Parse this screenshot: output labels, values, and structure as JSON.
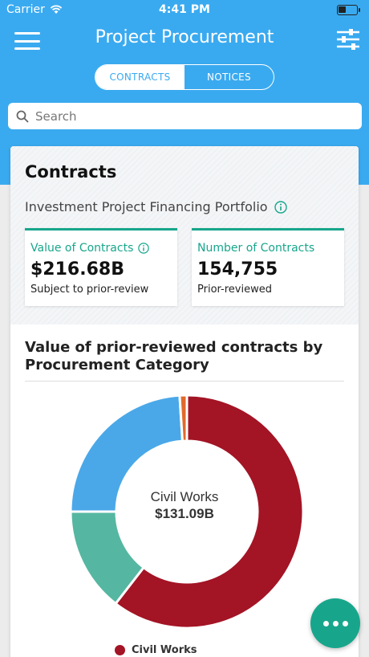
{
  "status": {
    "carrier": "Carrier",
    "time": "4:41 PM"
  },
  "nav": {
    "title": "Project Procurement"
  },
  "tabs": {
    "contracts": "CONTRACTS",
    "notices": "NOTICES"
  },
  "search": {
    "placeholder": "Search"
  },
  "card": {
    "title": "Contracts",
    "portfolio": "Investment Project Financing Portfolio",
    "kpis": [
      {
        "label": "Value of Contracts",
        "value": "$216.68B",
        "sub": "Subject to prior-review"
      },
      {
        "label": "Number of Contracts",
        "value": "154,755",
        "sub": "Prior-reviewed"
      }
    ]
  },
  "chart_data": {
    "type": "pie",
    "title": "Value of prior-reviewed contracts by Procurement Category",
    "center_label": "Civil Works",
    "center_value": "$131.09B",
    "categories": [
      "Civil Works",
      "",
      "",
      ""
    ],
    "values": [
      60.5,
      14.5,
      24.0,
      1.0
    ],
    "colors": [
      "#a31425",
      "#55b7a1",
      "#4aa8e8",
      "#e06a2c"
    ],
    "legend": [
      {
        "name": "Civil Works",
        "color": "#a31425"
      }
    ]
  },
  "colors": {
    "header": "#3aaaf0",
    "accent": "#17a68c"
  },
  "icons": {
    "menu": "hamburger-icon",
    "filter": "sliders-icon",
    "search": "search-icon",
    "info": "info-icon",
    "fab": "more-icon"
  }
}
